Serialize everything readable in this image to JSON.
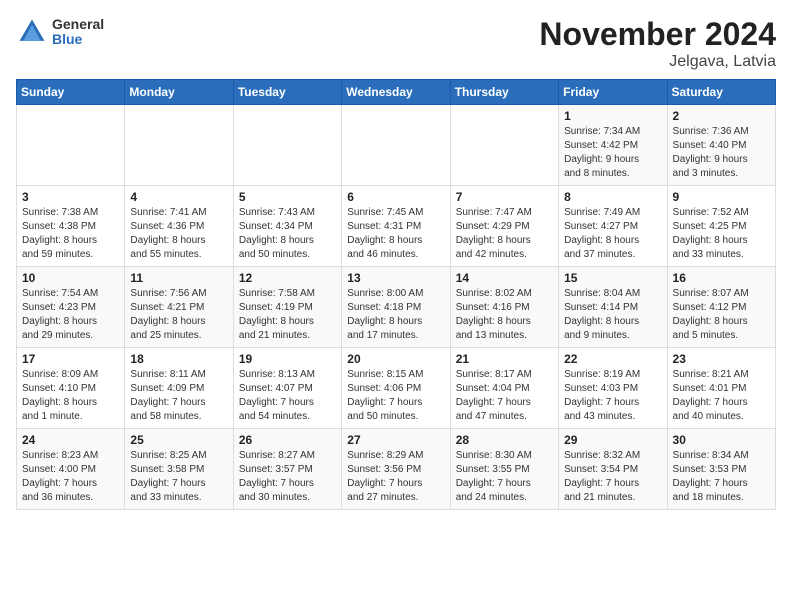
{
  "logo": {
    "general": "General",
    "blue": "Blue"
  },
  "title": "November 2024",
  "location": "Jelgava, Latvia",
  "days_of_week": [
    "Sunday",
    "Monday",
    "Tuesday",
    "Wednesday",
    "Thursday",
    "Friday",
    "Saturday"
  ],
  "weeks": [
    [
      {
        "day": "",
        "detail": ""
      },
      {
        "day": "",
        "detail": ""
      },
      {
        "day": "",
        "detail": ""
      },
      {
        "day": "",
        "detail": ""
      },
      {
        "day": "",
        "detail": ""
      },
      {
        "day": "1",
        "detail": "Sunrise: 7:34 AM\nSunset: 4:42 PM\nDaylight: 9 hours\nand 8 minutes."
      },
      {
        "day": "2",
        "detail": "Sunrise: 7:36 AM\nSunset: 4:40 PM\nDaylight: 9 hours\nand 3 minutes."
      }
    ],
    [
      {
        "day": "3",
        "detail": "Sunrise: 7:38 AM\nSunset: 4:38 PM\nDaylight: 8 hours\nand 59 minutes."
      },
      {
        "day": "4",
        "detail": "Sunrise: 7:41 AM\nSunset: 4:36 PM\nDaylight: 8 hours\nand 55 minutes."
      },
      {
        "day": "5",
        "detail": "Sunrise: 7:43 AM\nSunset: 4:34 PM\nDaylight: 8 hours\nand 50 minutes."
      },
      {
        "day": "6",
        "detail": "Sunrise: 7:45 AM\nSunset: 4:31 PM\nDaylight: 8 hours\nand 46 minutes."
      },
      {
        "day": "7",
        "detail": "Sunrise: 7:47 AM\nSunset: 4:29 PM\nDaylight: 8 hours\nand 42 minutes."
      },
      {
        "day": "8",
        "detail": "Sunrise: 7:49 AM\nSunset: 4:27 PM\nDaylight: 8 hours\nand 37 minutes."
      },
      {
        "day": "9",
        "detail": "Sunrise: 7:52 AM\nSunset: 4:25 PM\nDaylight: 8 hours\nand 33 minutes."
      }
    ],
    [
      {
        "day": "10",
        "detail": "Sunrise: 7:54 AM\nSunset: 4:23 PM\nDaylight: 8 hours\nand 29 minutes."
      },
      {
        "day": "11",
        "detail": "Sunrise: 7:56 AM\nSunset: 4:21 PM\nDaylight: 8 hours\nand 25 minutes."
      },
      {
        "day": "12",
        "detail": "Sunrise: 7:58 AM\nSunset: 4:19 PM\nDaylight: 8 hours\nand 21 minutes."
      },
      {
        "day": "13",
        "detail": "Sunrise: 8:00 AM\nSunset: 4:18 PM\nDaylight: 8 hours\nand 17 minutes."
      },
      {
        "day": "14",
        "detail": "Sunrise: 8:02 AM\nSunset: 4:16 PM\nDaylight: 8 hours\nand 13 minutes."
      },
      {
        "day": "15",
        "detail": "Sunrise: 8:04 AM\nSunset: 4:14 PM\nDaylight: 8 hours\nand 9 minutes."
      },
      {
        "day": "16",
        "detail": "Sunrise: 8:07 AM\nSunset: 4:12 PM\nDaylight: 8 hours\nand 5 minutes."
      }
    ],
    [
      {
        "day": "17",
        "detail": "Sunrise: 8:09 AM\nSunset: 4:10 PM\nDaylight: 8 hours\nand 1 minute."
      },
      {
        "day": "18",
        "detail": "Sunrise: 8:11 AM\nSunset: 4:09 PM\nDaylight: 7 hours\nand 58 minutes."
      },
      {
        "day": "19",
        "detail": "Sunrise: 8:13 AM\nSunset: 4:07 PM\nDaylight: 7 hours\nand 54 minutes."
      },
      {
        "day": "20",
        "detail": "Sunrise: 8:15 AM\nSunset: 4:06 PM\nDaylight: 7 hours\nand 50 minutes."
      },
      {
        "day": "21",
        "detail": "Sunrise: 8:17 AM\nSunset: 4:04 PM\nDaylight: 7 hours\nand 47 minutes."
      },
      {
        "day": "22",
        "detail": "Sunrise: 8:19 AM\nSunset: 4:03 PM\nDaylight: 7 hours\nand 43 minutes."
      },
      {
        "day": "23",
        "detail": "Sunrise: 8:21 AM\nSunset: 4:01 PM\nDaylight: 7 hours\nand 40 minutes."
      }
    ],
    [
      {
        "day": "24",
        "detail": "Sunrise: 8:23 AM\nSunset: 4:00 PM\nDaylight: 7 hours\nand 36 minutes."
      },
      {
        "day": "25",
        "detail": "Sunrise: 8:25 AM\nSunset: 3:58 PM\nDaylight: 7 hours\nand 33 minutes."
      },
      {
        "day": "26",
        "detail": "Sunrise: 8:27 AM\nSunset: 3:57 PM\nDaylight: 7 hours\nand 30 minutes."
      },
      {
        "day": "27",
        "detail": "Sunrise: 8:29 AM\nSunset: 3:56 PM\nDaylight: 7 hours\nand 27 minutes."
      },
      {
        "day": "28",
        "detail": "Sunrise: 8:30 AM\nSunset: 3:55 PM\nDaylight: 7 hours\nand 24 minutes."
      },
      {
        "day": "29",
        "detail": "Sunrise: 8:32 AM\nSunset: 3:54 PM\nDaylight: 7 hours\nand 21 minutes."
      },
      {
        "day": "30",
        "detail": "Sunrise: 8:34 AM\nSunset: 3:53 PM\nDaylight: 7 hours\nand 18 minutes."
      }
    ]
  ]
}
